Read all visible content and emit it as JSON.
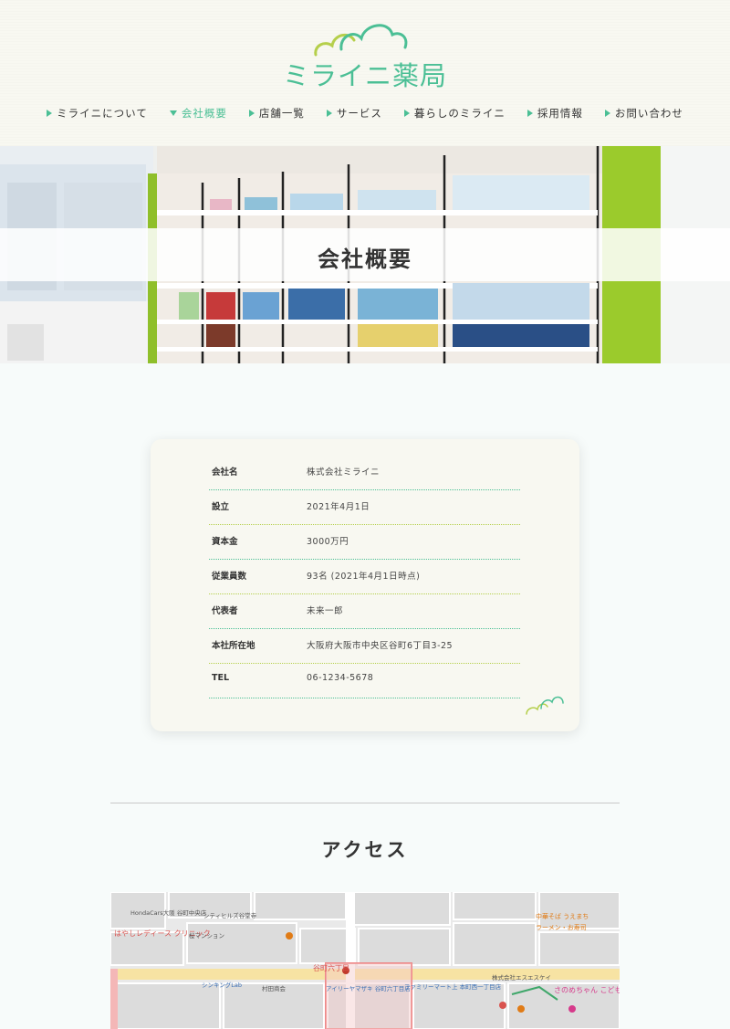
{
  "header": {
    "logo_text": "ミライニ薬局",
    "nav": [
      {
        "label": "ミライニについて",
        "active": false
      },
      {
        "label": "会社概要",
        "active": true
      },
      {
        "label": "店舗一覧",
        "active": false
      },
      {
        "label": "サービス",
        "active": false
      },
      {
        "label": "暮らしのミライニ",
        "active": false
      },
      {
        "label": "採用情報",
        "active": false
      },
      {
        "label": "お問い合わせ",
        "active": false
      }
    ]
  },
  "hero": {
    "title": "会社概要"
  },
  "company": {
    "rows": [
      {
        "label": "会社名",
        "value": "株式会社ミライニ"
      },
      {
        "label": "設立",
        "value": "2021年4月1日"
      },
      {
        "label": "資本金",
        "value": "3000万円"
      },
      {
        "label": "従業員数",
        "value": "93名 (2021年4月1日時点)"
      },
      {
        "label": "代表者",
        "value": "未来一郎"
      },
      {
        "label": "本社所在地",
        "value": "大阪府大阪市中央区谷町6丁目3-25"
      },
      {
        "label": "TEL",
        "value": "06-1234-5678"
      }
    ]
  },
  "access": {
    "title": "アクセス"
  },
  "map": {
    "labels": {
      "l1": "シティヒルズ谷堂寺",
      "l2": "HondaCars大阪 谷町中央店",
      "l3": "はやしレディース クリニック",
      "l4": "桜マンション",
      "l5": "シンキングLab",
      "l6": "村田商会",
      "l7": "谷町六丁目",
      "l8": "ファミリーマート上 本町西一丁目店",
      "l9": "株式会社エスエスケイ",
      "l10": "中華そば うえまち",
      "l11": "さのめちゃん こどもクリニック",
      "l12": "アイリーヤマザキ 谷町六丁目店",
      "l13": "ラーメン・お寿司"
    }
  },
  "colors": {
    "accent": "#4bbf95",
    "accent_light": "#b5cf4b",
    "header_bg": "#f8f8f1",
    "page_bg": "#f7fbfa"
  }
}
